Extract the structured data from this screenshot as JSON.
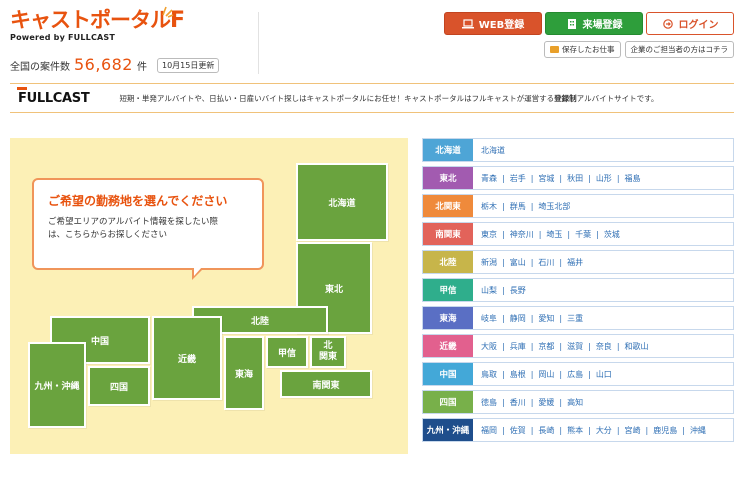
{
  "header": {
    "logo_text": "キャストポータル",
    "logo_suffix": "F",
    "powered_by": "Powered by FULLCAST",
    "count_label": "全国の案件数",
    "count_value": "56,682",
    "count_unit": "件",
    "updated": "10月15日更新"
  },
  "buttons": {
    "web": "WEB登録",
    "visit": "来場登録",
    "login": "ログイン",
    "saved_jobs": "保存したお仕事",
    "corporate": "企業のご担当者の方はコチラ"
  },
  "band": {
    "brand": "FULLCAST",
    "text_pre": "短期・単発アルバイトや、日払い・日雇いバイト探しはキャストポータルにお任せ！キャストポータルはフルキャストが運営する",
    "text_bold": "登録制",
    "text_post": "アルバイトサイトです。"
  },
  "map": {
    "bubble_title": "ご希望の勤務地を選んでください",
    "bubble_body_1": "ご希望エリアのアルバイト情報を探したい際",
    "bubble_body_2": "は、こちらからお探しください",
    "hokkaido": "北海道",
    "tohoku": "東北",
    "hokuriku": "北陸",
    "koshin": "甲信",
    "kitakanto": "北\n関東",
    "minamikanto": "南関東",
    "tokai": "東海",
    "kinki": "近畿",
    "chugoku": "中国",
    "shikoku": "四国",
    "kyushu": "九州・沖縄"
  },
  "regions": [
    {
      "name": "北海道",
      "color": "#4ea5d6",
      "prefs": [
        "北海道"
      ]
    },
    {
      "name": "東北",
      "color": "#a25bb0",
      "prefs": [
        "青森",
        "岩手",
        "宮城",
        "秋田",
        "山形",
        "福島"
      ]
    },
    {
      "name": "北関東",
      "color": "#ef8a3b",
      "prefs": [
        "栃木",
        "群馬",
        "埼玉北部"
      ]
    },
    {
      "name": "南関東",
      "color": "#e2635a",
      "prefs": [
        "東京",
        "神奈川",
        "埼玉",
        "千葉",
        "茨城"
      ]
    },
    {
      "name": "北陸",
      "color": "#c7b54a",
      "prefs": [
        "新潟",
        "富山",
        "石川",
        "福井"
      ]
    },
    {
      "name": "甲信",
      "color": "#2fae8c",
      "prefs": [
        "山梨",
        "長野"
      ]
    },
    {
      "name": "東海",
      "color": "#5a6fc4",
      "prefs": [
        "岐阜",
        "静岡",
        "愛知",
        "三重"
      ]
    },
    {
      "name": "近畿",
      "color": "#e2608e",
      "prefs": [
        "大阪",
        "兵庫",
        "京都",
        "滋賀",
        "奈良",
        "和歌山"
      ]
    },
    {
      "name": "中国",
      "color": "#43a8d8",
      "prefs": [
        "鳥取",
        "島根",
        "岡山",
        "広島",
        "山口"
      ]
    },
    {
      "name": "四国",
      "color": "#78b04a",
      "prefs": [
        "徳島",
        "香川",
        "愛媛",
        "高知"
      ]
    },
    {
      "name": "九州・沖縄",
      "color": "#1f4e8c",
      "prefs": [
        "福岡",
        "佐賀",
        "長崎",
        "熊本",
        "大分",
        "宮崎",
        "鹿児島",
        "沖縄"
      ]
    }
  ]
}
